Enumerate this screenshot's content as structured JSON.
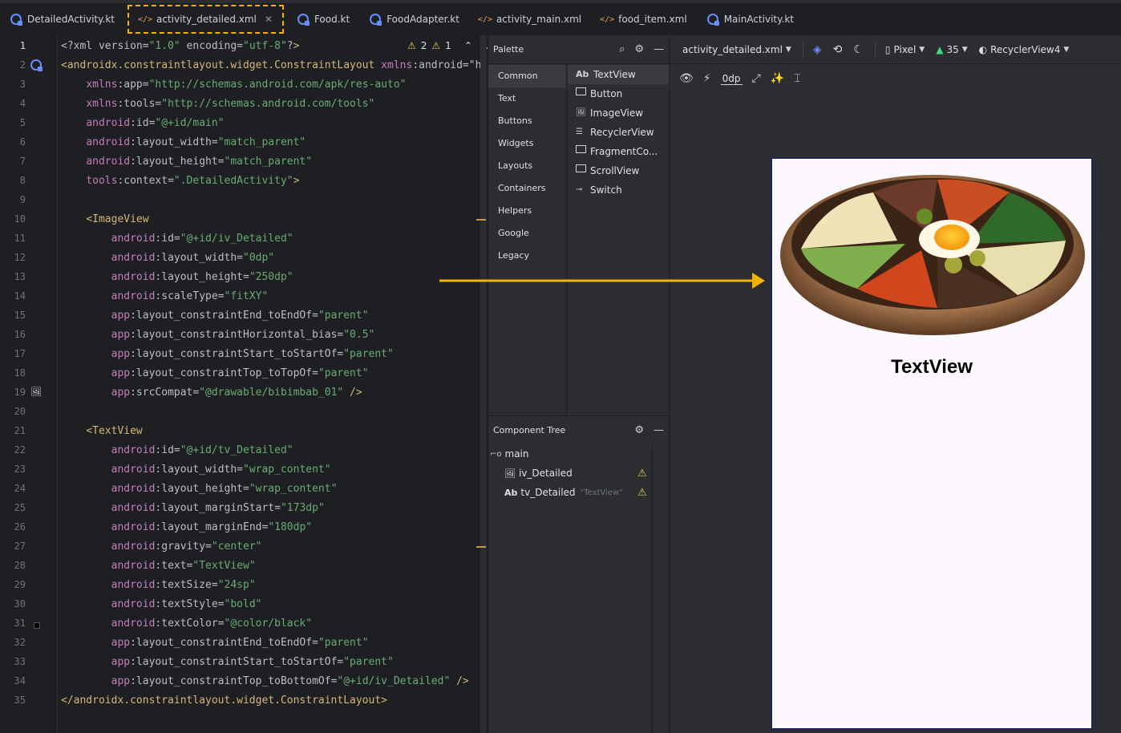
{
  "tabs": [
    {
      "label": "DetailedActivity.kt",
      "type": "kt"
    },
    {
      "label": "activity_detailed.xml",
      "type": "xml",
      "active": true
    },
    {
      "label": "Food.kt",
      "type": "kt"
    },
    {
      "label": "FoodAdapter.kt",
      "type": "kt"
    },
    {
      "label": "activity_main.xml",
      "type": "xml"
    },
    {
      "label": "food_item.xml",
      "type": "xml"
    },
    {
      "label": "MainActivity.kt",
      "type": "kt"
    }
  ],
  "editor": {
    "warnings": "2",
    "weak_warnings": "1",
    "line_numbers": [
      "1",
      "2",
      "3",
      "4",
      "5",
      "6",
      "7",
      "8",
      "9",
      "10",
      "11",
      "12",
      "13",
      "14",
      "15",
      "16",
      "17",
      "18",
      "19",
      "20",
      "21",
      "22",
      "23",
      "24",
      "25",
      "26",
      "27",
      "28",
      "29",
      "30",
      "31",
      "32",
      "33",
      "34",
      "35"
    ],
    "lines": [
      "<?xml version=\"1.0\" encoding=\"utf-8\"?>",
      "<androidx.constraintlayout.widget.ConstraintLayout xmlns:android=\"h",
      "    xmlns:app=\"http://schemas.android.com/apk/res-auto\"",
      "    xmlns:tools=\"http://schemas.android.com/tools\"",
      "    android:id=\"@+id/main\"",
      "    android:layout_width=\"match_parent\"",
      "    android:layout_height=\"match_parent\"",
      "    tools:context=\".DetailedActivity\">",
      "",
      "    <ImageView",
      "        android:id=\"@+id/iv_Detailed\"",
      "        android:layout_width=\"0dp\"",
      "        android:layout_height=\"250dp\"",
      "        android:scaleType=\"fitXY\"",
      "        app:layout_constraintEnd_toEndOf=\"parent\"",
      "        app:layout_constraintHorizontal_bias=\"0.5\"",
      "        app:layout_constraintStart_toStartOf=\"parent\"",
      "        app:layout_constraintTop_toTopOf=\"parent\"",
      "        app:srcCompat=\"@drawable/bibimbab_01\" />",
      "",
      "    <TextView",
      "        android:id=\"@+id/tv_Detailed\"",
      "        android:layout_width=\"wrap_content\"",
      "        android:layout_height=\"wrap_content\"",
      "        android:layout_marginStart=\"173dp\"",
      "        android:layout_marginEnd=\"180dp\"",
      "        android:gravity=\"center\"",
      "        android:text=\"TextView\"",
      "        android:textSize=\"24sp\"",
      "        android:textStyle=\"bold\"",
      "        android:textColor=\"@color/black\"",
      "        app:layout_constraintEnd_toEndOf=\"parent\"",
      "        app:layout_constraintStart_toStartOf=\"parent\"",
      "        app:layout_constraintTop_toBottomOf=\"@+id/iv_Detailed\" />",
      "</androidx.constraintlayout.widget.ConstraintLayout>"
    ]
  },
  "palette": {
    "title": "Palette",
    "categories": [
      "Common",
      "Text",
      "Buttons",
      "Widgets",
      "Layouts",
      "Containers",
      "Helpers",
      "Google",
      "Legacy"
    ],
    "widgets": [
      "TextView",
      "Button",
      "ImageView",
      "RecyclerView",
      "FragmentCo...",
      "ScrollView",
      "Switch"
    ],
    "textview_icon": "Ab"
  },
  "component_tree": {
    "title": "Component Tree",
    "root": "main",
    "children": [
      {
        "label": "iv_Detailed",
        "sub": ""
      },
      {
        "label": "tv_Detailed",
        "sub": "\"TextView\"",
        "icon": "Ab"
      }
    ]
  },
  "design": {
    "file_select": "activity_detailed.xml",
    "device": "Pixel",
    "api": "35",
    "theme": "RecyclerView4",
    "margin": "0dp",
    "preview_text": "TextView"
  },
  "colors": {
    "highlight": "#f0b400",
    "arrow": "#f0b400"
  }
}
